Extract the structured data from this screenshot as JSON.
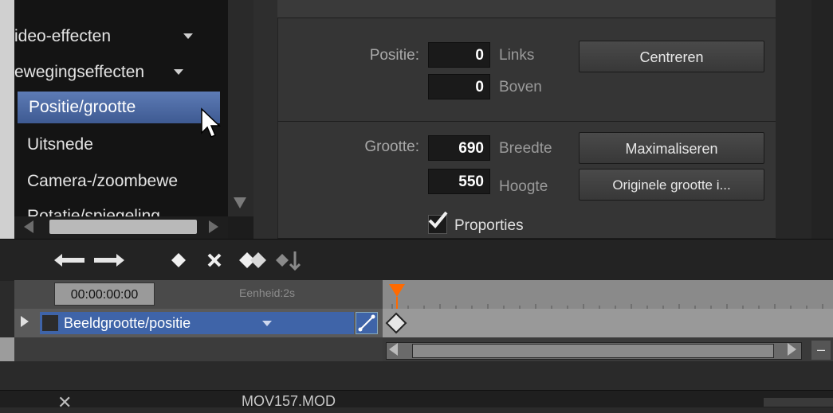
{
  "effects_list": {
    "items": [
      {
        "label": "ideo-effecten",
        "type": "category"
      },
      {
        "label": "ewegingseffecten",
        "type": "category"
      },
      {
        "label": "Positie/grootte",
        "type": "item",
        "selected": true
      },
      {
        "label": "Uitsnede",
        "type": "item"
      },
      {
        "label": "Camera-/zoombewe",
        "type": "item"
      },
      {
        "label": "Rotatie/spiegeling",
        "type": "item"
      }
    ]
  },
  "properties": {
    "position": {
      "label": "Positie:",
      "left_value": "0",
      "left_unit": "Links",
      "top_value": "0",
      "top_unit": "Boven",
      "center_button": "Centreren"
    },
    "size": {
      "label": "Grootte:",
      "width_value": "690",
      "width_unit": "Breedte",
      "height_value": "550",
      "height_unit": "Hoogte",
      "maximize_button": "Maximaliseren",
      "original_button": "Originele grootte i..."
    },
    "proportions": {
      "label": "Proporties",
      "checked": true
    }
  },
  "timeline": {
    "timecode": "00:00:00:00",
    "unit_label": "Eenheid:2s",
    "track_name": "Beeldgrootte/positie",
    "zoom_out": "–"
  },
  "bottom_bar": {
    "clip_name": "MOV157.MOD",
    "close_glyph": "✕"
  },
  "colors": {
    "selection": "#4e6ca4",
    "track": "#3f64a8",
    "playhead": "#ff6a00"
  }
}
